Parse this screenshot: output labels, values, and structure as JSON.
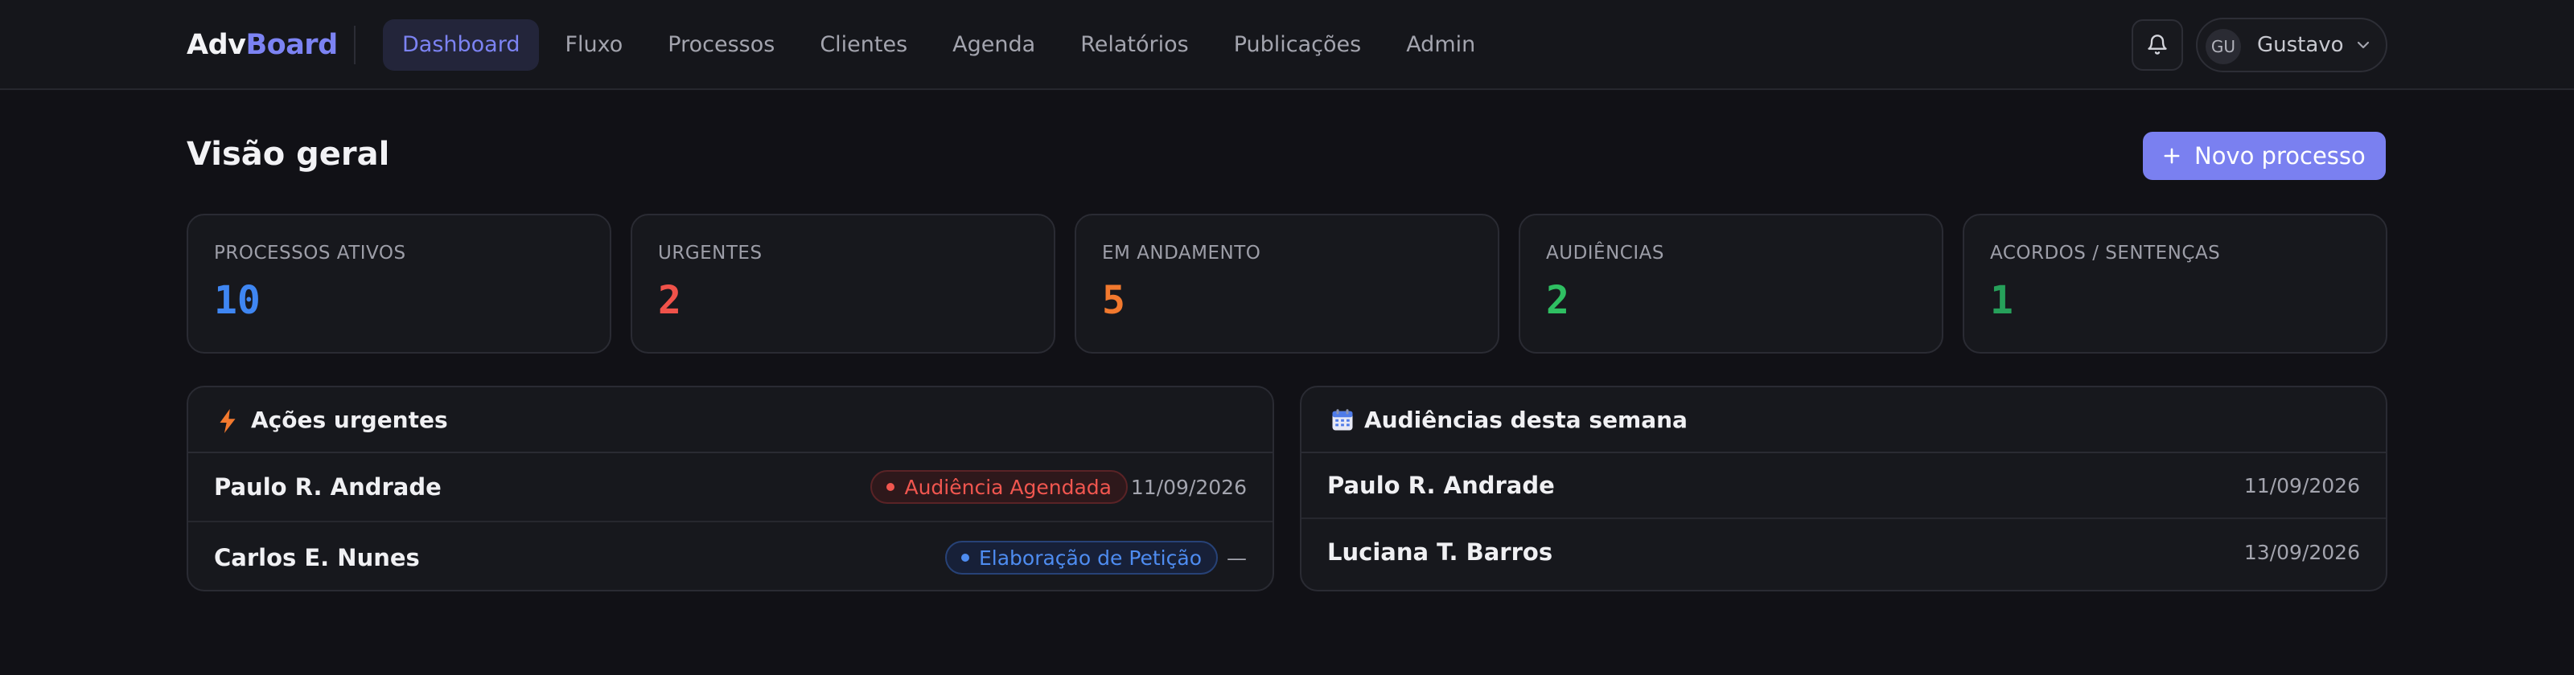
{
  "nav": {
    "logo_a": "Adv",
    "logo_b": "Board",
    "links": [
      "Dashboard",
      "Fluxo",
      "Processos",
      "Clientes",
      "Agenda",
      "Relatórios",
      "Publicações",
      "Admin"
    ],
    "active_index": 0,
    "user": {
      "initials": "GU",
      "name": "Gustavo"
    }
  },
  "header": {
    "title": "Visão geral",
    "new_button": "Novo processo"
  },
  "stats": [
    {
      "label": "PROCESSOS ATIVOS",
      "value": "10",
      "color": "#3f86f2"
    },
    {
      "label": "URGENTES",
      "value": "2",
      "color": "#f0524a"
    },
    {
      "label": "EM ANDAMENTO",
      "value": "5",
      "color": "#f2792e"
    },
    {
      "label": "AUDIÊNCIAS",
      "value": "2",
      "color": "#2fbf62"
    },
    {
      "label": "ACORDOS / SENTENÇAS",
      "value": "1",
      "color": "#26a05a"
    }
  ],
  "urgent": {
    "title": "Ações urgentes",
    "rows": [
      {
        "name": "Paulo R. Andrade",
        "badge": "Audiência Agendada",
        "badge_color": "red",
        "date": "11/09/2026"
      },
      {
        "name": "Carlos E. Nunes",
        "badge": "Elaboração de Petição",
        "badge_color": "blue",
        "date": "—"
      }
    ]
  },
  "hearings": {
    "title": "Audiências desta semana",
    "rows": [
      {
        "name": "Paulo R. Andrade",
        "date": "11/09/2026"
      },
      {
        "name": "Luciana T. Barros",
        "date": "13/09/2026"
      }
    ]
  },
  "colors": {
    "accent": "#7a80f0",
    "background": "#111116",
    "card": "#17181d"
  }
}
